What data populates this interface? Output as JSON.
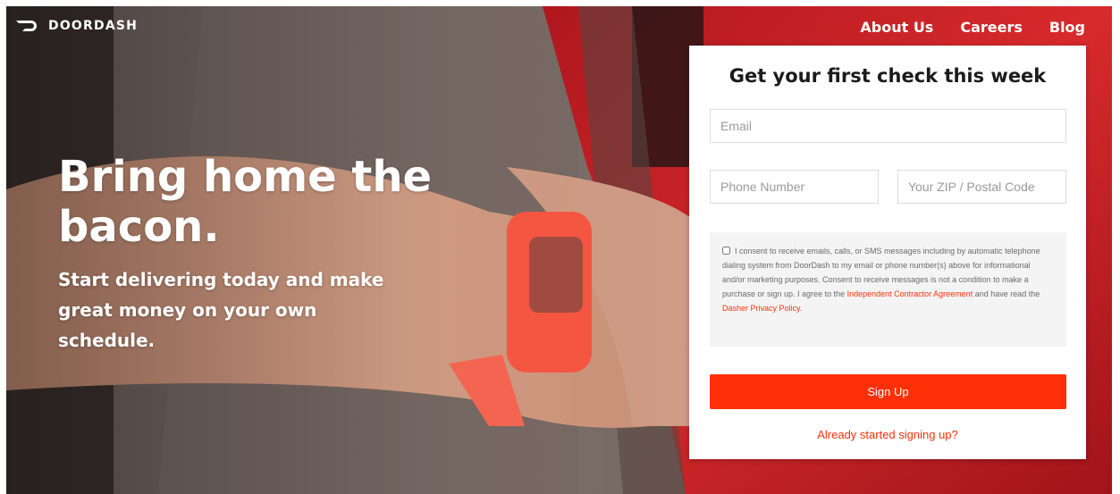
{
  "brand": {
    "name": "DOORDASH",
    "color": "#ff3008"
  },
  "nav": {
    "items": [
      {
        "label": "About Us"
      },
      {
        "label": "Careers"
      },
      {
        "label": "Blog"
      }
    ]
  },
  "hero": {
    "headline": "Bring home the bacon.",
    "subhead": "Start delivering today and make great money on your own schedule."
  },
  "form": {
    "title": "Get your first check this week",
    "email_placeholder": "Email",
    "phone_placeholder": "Phone Number",
    "zip_placeholder": "Your ZIP / Postal Code",
    "consent": {
      "text_1": "I consent to receive emails, calls, or SMS messages including by automatic telephone dialing system from DoorDash to my email or phone number(s) above for informational and/or marketing purposes. Consent to receive messages is not a condition to make a purchase or sign up. I agree to the ",
      "link_1": "Independent Contractor Agreement",
      "text_2": " and have read the ",
      "link_2": "Dasher Privacy Policy",
      "text_3": "."
    },
    "submit_label": "Sign Up",
    "already_label": "Already started signing up?"
  }
}
